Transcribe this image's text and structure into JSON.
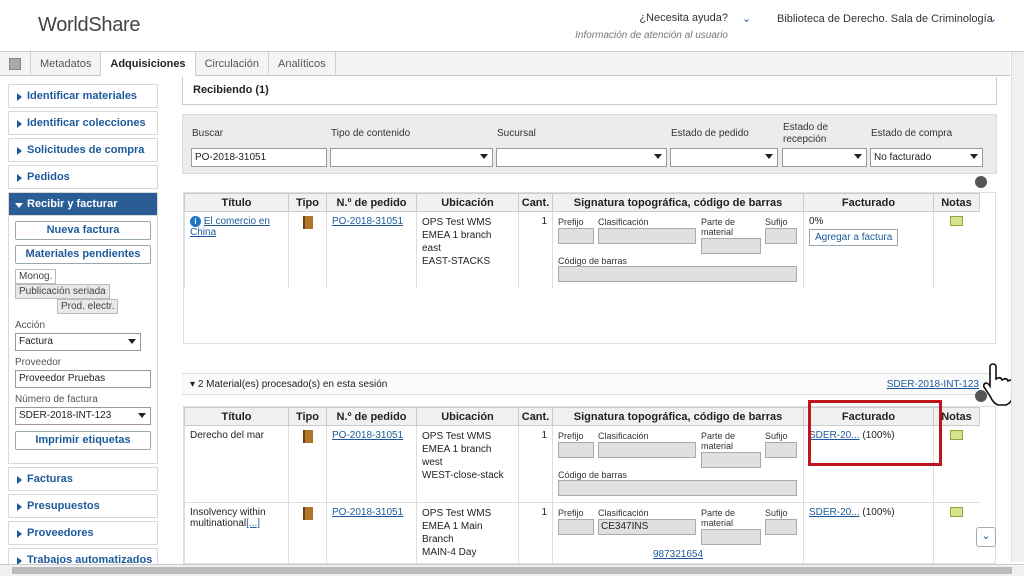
{
  "header": {
    "logo_text": "WorldShare",
    "help_question": "¿Necesita ayuda?",
    "help_sub": "Información de atención al usuario",
    "library": "Biblioteca de Derecho. Sala de Criminología"
  },
  "tabs": [
    "Metadatos",
    "Adquisiciones",
    "Circulación",
    "Analíticos"
  ],
  "active_tab": "Adquisiciones",
  "sidebar": {
    "items_top": [
      "Identificar materiales",
      "Identificar colecciones",
      "Solicitudes de compra",
      "Pedidos"
    ],
    "open_item": "Recibir y facturar",
    "new_invoice": "Nueva factura",
    "pending": "Materiales pendientes",
    "subtabs": [
      "Monog.",
      "Publicación seriada",
      "Prod. electr."
    ],
    "action_label": "Acción",
    "action_value": "Factura",
    "vendor_label": "Proveedor",
    "vendor_value": "Proveedor Pruebas",
    "invoice_label": "Número de factura",
    "invoice_value": "SDER-2018-INT-123",
    "print_labels": "Imprimir etiquetas",
    "items_bottom": [
      "Facturas",
      "Presupuestos",
      "Proveedores",
      "Trabajos automatizados"
    ]
  },
  "receiving": {
    "title": "Recibiendo (1)",
    "search_label": "Buscar",
    "search_value": "PO-2018-31051",
    "content_type_label": "Tipo de contenido",
    "branch_label": "Sucursal",
    "order_status_label": "Estado de pedido",
    "receipt_status_label_1": "Estado de",
    "receipt_status_label_2": "recepción",
    "purchase_status_label": "Estado de compra",
    "purchase_status_value": "No facturado"
  },
  "columns": [
    "Título",
    "Tipo",
    "N.º de pedido",
    "Ubicación",
    "Cant.",
    "Signatura topográfica, código de barras",
    "Facturado",
    "Notas"
  ],
  "sig_labels": {
    "prefix": "Prefijo",
    "class": "Clasificación",
    "part1": "Parte de",
    "part2": "material",
    "suffix": "Sufijo",
    "barcode": "Código de barras"
  },
  "row1": {
    "title": "El comercio en China",
    "order": "PO-2018-31051",
    "loc": [
      "OPS Test WMS",
      "EMEA 1 branch",
      "east",
      "EAST-STACKS"
    ],
    "qty": "1",
    "invoiced": "0%",
    "add_button": "Agregar a factura"
  },
  "session": {
    "text": "2 Material(es) procesado(s) en esta sesión",
    "invoice_link": "SDER-2018-INT-123"
  },
  "rows2": [
    {
      "title": "Derecho del mar",
      "more": "",
      "order": "PO-2018-31051",
      "loc": [
        "OPS Test WMS",
        "EMEA 1 branch",
        "west",
        "WEST-close-stack"
      ],
      "qty": "1",
      "class": "",
      "barcode": "",
      "inv_link": "SDER-20...",
      "inv_pct": "(100%)"
    },
    {
      "title": "Insolvency within multinational",
      "more": "[...]",
      "order": "PO-2018-31051",
      "loc": [
        "OPS Test WMS",
        "EMEA 1 Main",
        "Branch",
        "MAIN-4 Day"
      ],
      "qty": "1",
      "class": "CE347INS",
      "barcode": "987321654",
      "inv_link": "SDER-20...",
      "inv_pct": "(100%)"
    }
  ]
}
